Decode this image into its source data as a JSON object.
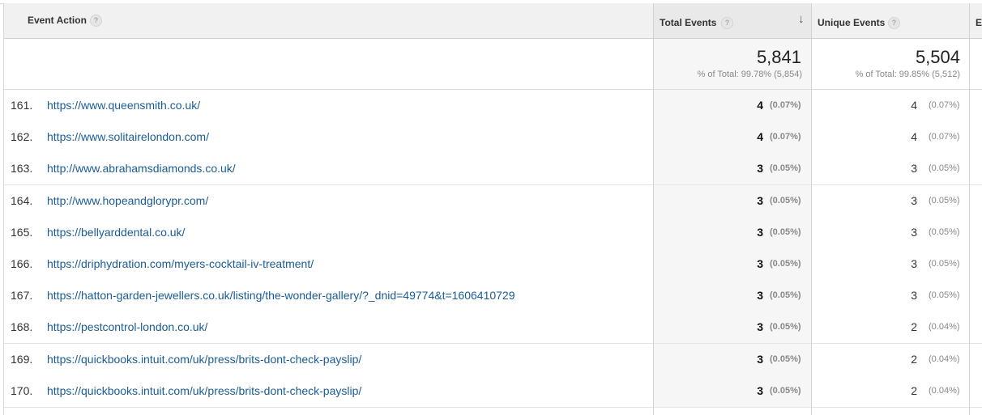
{
  "columns": {
    "event_action": "Event Action",
    "total_events": "Total Events",
    "unique_events": "Unique Events",
    "next_col": "E",
    "help_glyph": "?",
    "sort_glyph": "↓"
  },
  "summary": {
    "total_events": "5,841",
    "total_events_pct": "% of Total: 99.78% (5,854)",
    "unique_events": "5,504",
    "unique_events_pct": "% of Total: 99.85% (5,512)"
  },
  "rows": [
    {
      "idx": "161.",
      "url": "https://www.queensmith.co.uk/",
      "te": "4",
      "te_pct": "(0.07%)",
      "ue": "4",
      "ue_pct": "(0.07%)"
    },
    {
      "idx": "162.",
      "url": "https://www.solitairelondon.com/",
      "te": "4",
      "te_pct": "(0.07%)",
      "ue": "4",
      "ue_pct": "(0.07%)"
    },
    {
      "idx": "163.",
      "url": "http://www.abrahamsdiamonds.co.uk/",
      "te": "3",
      "te_pct": "(0.05%)",
      "ue": "3",
      "ue_pct": "(0.05%)"
    },
    {
      "idx": "164.",
      "url": "http://www.hopeandglorypr.com/",
      "te": "3",
      "te_pct": "(0.05%)",
      "ue": "3",
      "ue_pct": "(0.05%)"
    },
    {
      "idx": "165.",
      "url": "https://bellyarddental.co.uk/",
      "te": "3",
      "te_pct": "(0.05%)",
      "ue": "3",
      "ue_pct": "(0.05%)"
    },
    {
      "idx": "166.",
      "url": "https://driphydration.com/myers-cocktail-iv-treatment/",
      "te": "3",
      "te_pct": "(0.05%)",
      "ue": "3",
      "ue_pct": "(0.05%)"
    },
    {
      "idx": "167.",
      "url": "https://hatton-garden-jewellers.co.uk/listing/the-wonder-gallery/?_dnid=49774&t=1606410729",
      "te": "3",
      "te_pct": "(0.05%)",
      "ue": "3",
      "ue_pct": "(0.05%)"
    },
    {
      "idx": "168.",
      "url": "https://pestcontrol-london.co.uk/",
      "te": "3",
      "te_pct": "(0.05%)",
      "ue": "2",
      "ue_pct": "(0.04%)"
    },
    {
      "idx": "169.",
      "url": "https://quickbooks.intuit.com/uk/press/brits-dont-check-payslip/",
      "te": "3",
      "te_pct": "(0.05%)",
      "ue": "2",
      "ue_pct": "(0.04%)"
    },
    {
      "idx": "170.",
      "url": "https://quickbooks.intuit.com/uk/press/brits-dont-check-payslip/",
      "te": "3",
      "te_pct": "(0.05%)",
      "ue": "2",
      "ue_pct": "(0.04%)"
    }
  ]
}
